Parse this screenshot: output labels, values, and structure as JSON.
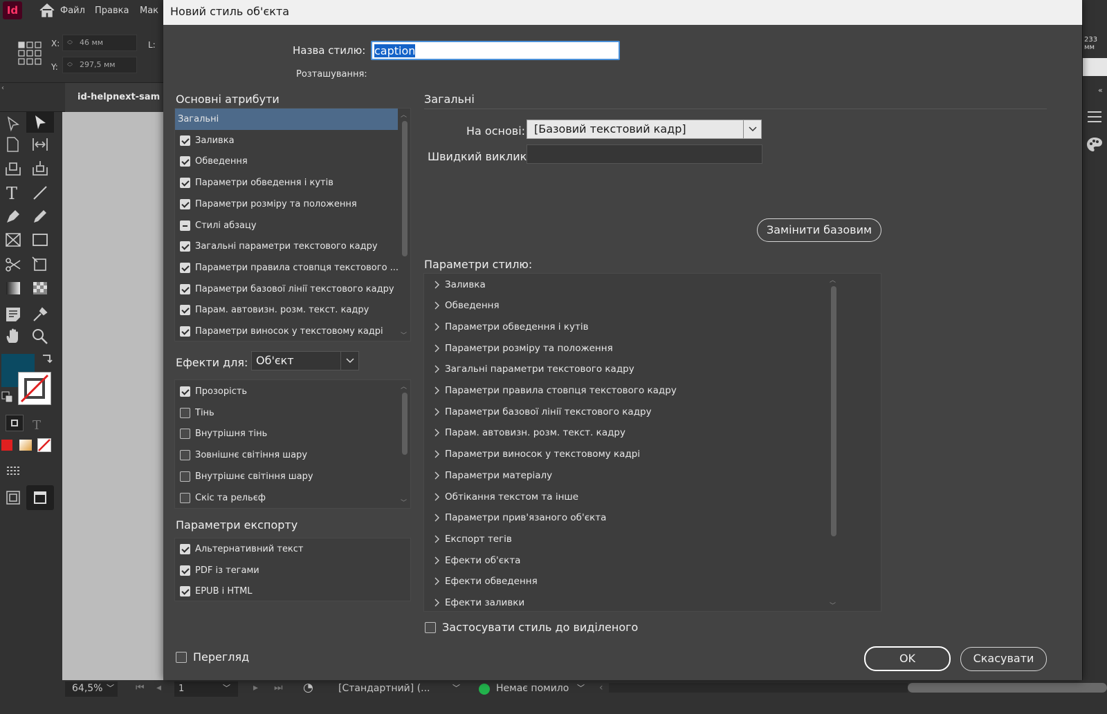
{
  "app": {
    "logo": "Id",
    "menu": [
      "Файл",
      "Правка",
      "Мак"
    ],
    "x_label": "X:",
    "x_value": "46 мм",
    "y_label": "Y:",
    "y_value": "297,5 мм",
    "l_label": "L:",
    "right_value": "233 мм",
    "document_tab": "id-helpnext-sam",
    "zoom": "64,5%",
    "page_number": "1",
    "page_style": "[Стандартний] (...",
    "preflight": "Немає помило",
    "fill_color": "#0b4a62",
    "preflight_color": "#22b24c"
  },
  "dialog": {
    "title": "Новий стиль об'єкта",
    "style_name_label": "Назва стилю:",
    "style_name_value": "caption",
    "location_label": "Розташування:",
    "basic_heading": "Основні атрибути",
    "basic_attributes": [
      {
        "label": "Загальні",
        "check": "none",
        "selected": true
      },
      {
        "label": "Заливка",
        "check": "on"
      },
      {
        "label": "Обведення",
        "check": "on"
      },
      {
        "label": "Параметри обведення і кутів",
        "check": "on"
      },
      {
        "label": "Параметри розміру та положення",
        "check": "on"
      },
      {
        "label": "Стилі абзацу",
        "check": "mixed"
      },
      {
        "label": "Загальні параметри текстового кадру",
        "check": "on"
      },
      {
        "label": "Параметри правила стовпця текстового ...",
        "check": "on"
      },
      {
        "label": "Параметри базової лінії текстового кадру",
        "check": "on"
      },
      {
        "label": "Парам. автовизн. розм. текст. кадру",
        "check": "on"
      },
      {
        "label": "Параметри виносок у текстовому кадрі",
        "check": "on"
      }
    ],
    "effects_for_label": "Ефекти для:",
    "effects_for_value": "Об'єкт",
    "effects": [
      {
        "label": "Прозорість",
        "check": "on"
      },
      {
        "label": "Тінь",
        "check": "off"
      },
      {
        "label": "Внутрішня тінь",
        "check": "off"
      },
      {
        "label": "Зовнішнє світіння шару",
        "check": "off"
      },
      {
        "label": "Внутрішнє світіння шару",
        "check": "off"
      },
      {
        "label": "Скіс та рельєф",
        "check": "off"
      }
    ],
    "export_heading": "Параметри експорту",
    "export_options": [
      {
        "label": "Альтернативний текст",
        "check": "on"
      },
      {
        "label": "PDF із тегами",
        "check": "on"
      },
      {
        "label": "EPUB і HTML",
        "check": "on"
      }
    ],
    "general_heading": "Загальні",
    "based_on_label": "На основі:",
    "based_on_value": "[Базовий текстовий кадр]",
    "shortcut_label": "Швидкий виклик:",
    "shortcut_value": "",
    "reset_button": "Замінити базовим",
    "style_settings_heading": "Параметри стилю:",
    "style_settings": [
      "Заливка",
      "Обведення",
      "Параметри обведення і кутів",
      "Параметри розміру та положення",
      "Загальні параметри текстового кадру",
      "Параметри правила стовпця текстового кадру",
      "Параметри базової лінії текстового кадру",
      "Парам. автовизн. розм. текст. кадру",
      "Параметри виносок у текстовому кадрі",
      "Параметри матеріалу",
      "Обтікання текстом та інше",
      "Параметри прив'язаного об'єкта",
      "Експорт тегів",
      "Ефекти об'єкта",
      "Ефекти обведення",
      "Ефекти заливки"
    ],
    "apply_to_selection_label": "Застосувати стиль до виділеного",
    "preview_label": "Перегляд",
    "ok_button": "OK",
    "cancel_button": "Скасувати"
  }
}
